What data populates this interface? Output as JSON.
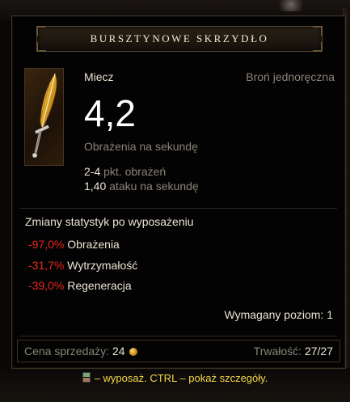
{
  "item": {
    "name": "BURSZTYNOWE SKRZYDŁO",
    "type": "Miecz",
    "slot": "Broń jednoręczna",
    "dps": "4,2",
    "dps_label": "Obrażenia na sekundę",
    "damage_value": "2-4",
    "damage_label": "pkt. obrażeń",
    "speed_value": "1,40",
    "speed_label": "ataku na sekundę",
    "icon": "golden-feather-sword-icon"
  },
  "stat_changes": {
    "heading": "Zmiany statystyk po wyposażeniu",
    "items": [
      {
        "delta": "-97,0%",
        "label": "Obrażenia"
      },
      {
        "delta": "-31,7%",
        "label": "Wytrzymałość"
      },
      {
        "delta": "-39,0%",
        "label": "Regeneracja"
      }
    ]
  },
  "required_level": "Wymagany poziom: 1",
  "footer": {
    "sell_label": "Cena sprzedaży:",
    "sell_value": "24",
    "durability_label": "Trwałość:",
    "durability_value": "27/27"
  },
  "hint": "– wyposaż. CTRL – pokaż szczegóły.",
  "colors": {
    "title_text": "#f2e9d6",
    "negative_stat": "#e32a1d",
    "hint_text": "#f4d64a",
    "muted_text": "#8a8377",
    "border": "#3b3023"
  }
}
